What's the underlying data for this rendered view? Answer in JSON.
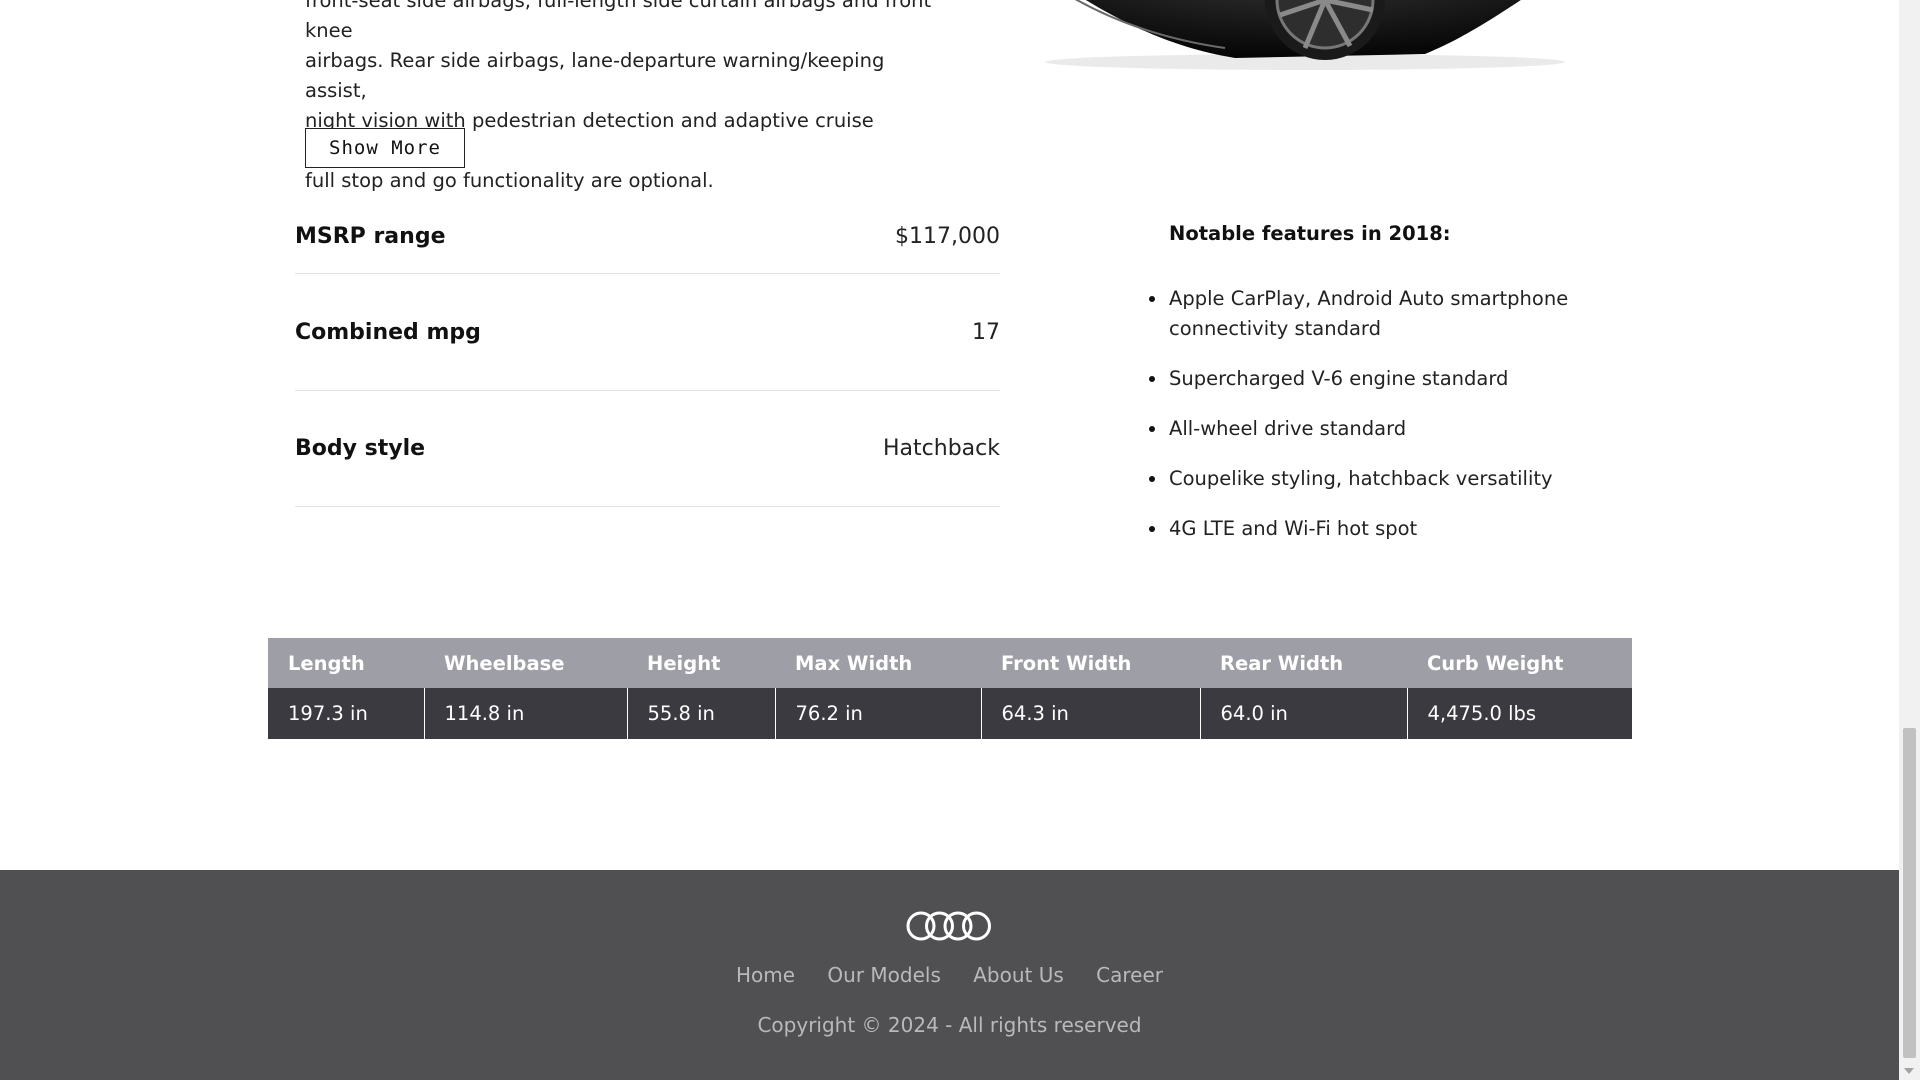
{
  "description": {
    "lines": [
      "front-seat side airbags, full-length side curtain airbags and front knee",
      "airbags. Rear side airbags, lane-departure warning/keeping assist,",
      "night vision with pedestrian detection and adaptive cruise control with",
      "full stop and go functionality are optional."
    ],
    "show_more_label": "Show More"
  },
  "specs": [
    {
      "label": "MSRP range",
      "value": "$117,000"
    },
    {
      "label": "Combined mpg",
      "value": "17"
    },
    {
      "label": "Body style",
      "value": "Hatchback"
    }
  ],
  "features": {
    "title": "Notable features in 2018:",
    "items": [
      "Apple CarPlay, Android Auto smartphone connectivity standard",
      "Supercharged V-6 engine standard",
      "All-wheel drive standard",
      "Coupelike styling, hatchback versatility",
      "4G LTE and Wi-Fi hot spot"
    ]
  },
  "dimensions": {
    "headers": [
      "Length",
      "Wheelbase",
      "Height",
      "Max Width",
      "Front Width",
      "Rear Width",
      "Curb Weight"
    ],
    "values": [
      "197.3 in",
      "114.8 in",
      "55.8 in",
      "76.2 in",
      "64.3 in",
      "64.0 in",
      "4,475.0 lbs"
    ]
  },
  "footer": {
    "logo_icon": "audi-rings-logo",
    "nav": [
      "Home",
      "Our Models",
      "About Us",
      "Career"
    ],
    "copyright": "Copyright © 2024 - All rights reserved"
  },
  "colors": {
    "table_header": "#9e9ea6",
    "table_body": "#3a3a40",
    "footer_bg": "#505052",
    "footer_text": "#b9b9bd"
  }
}
